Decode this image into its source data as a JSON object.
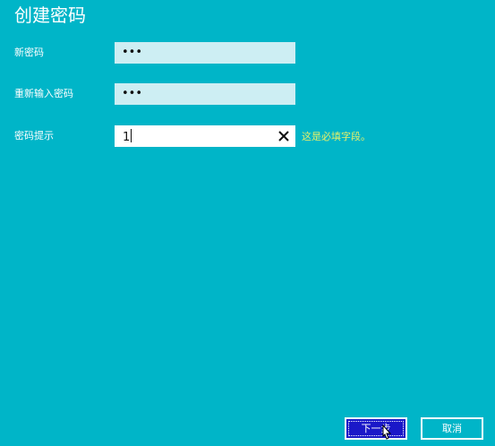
{
  "page": {
    "title": "创建密码"
  },
  "fields": {
    "new_password": {
      "label": "新密码",
      "value": "•••"
    },
    "confirm_password": {
      "label": "重新输入密码",
      "value": "•••"
    },
    "password_hint": {
      "label": "密码提示",
      "value": "1",
      "validation_message": "这是必填字段。"
    }
  },
  "icons": {
    "clear": "close-icon",
    "pointer": "mouse-pointer-icon"
  },
  "buttons": {
    "next_label": "下一步",
    "cancel_label": "取消"
  },
  "colors": {
    "background": "#00b5c8",
    "input_inactive": "#cdeef3",
    "input_active": "#ffffff",
    "validation_text": "#e6f06a",
    "primary_button": "#1a18c8"
  }
}
